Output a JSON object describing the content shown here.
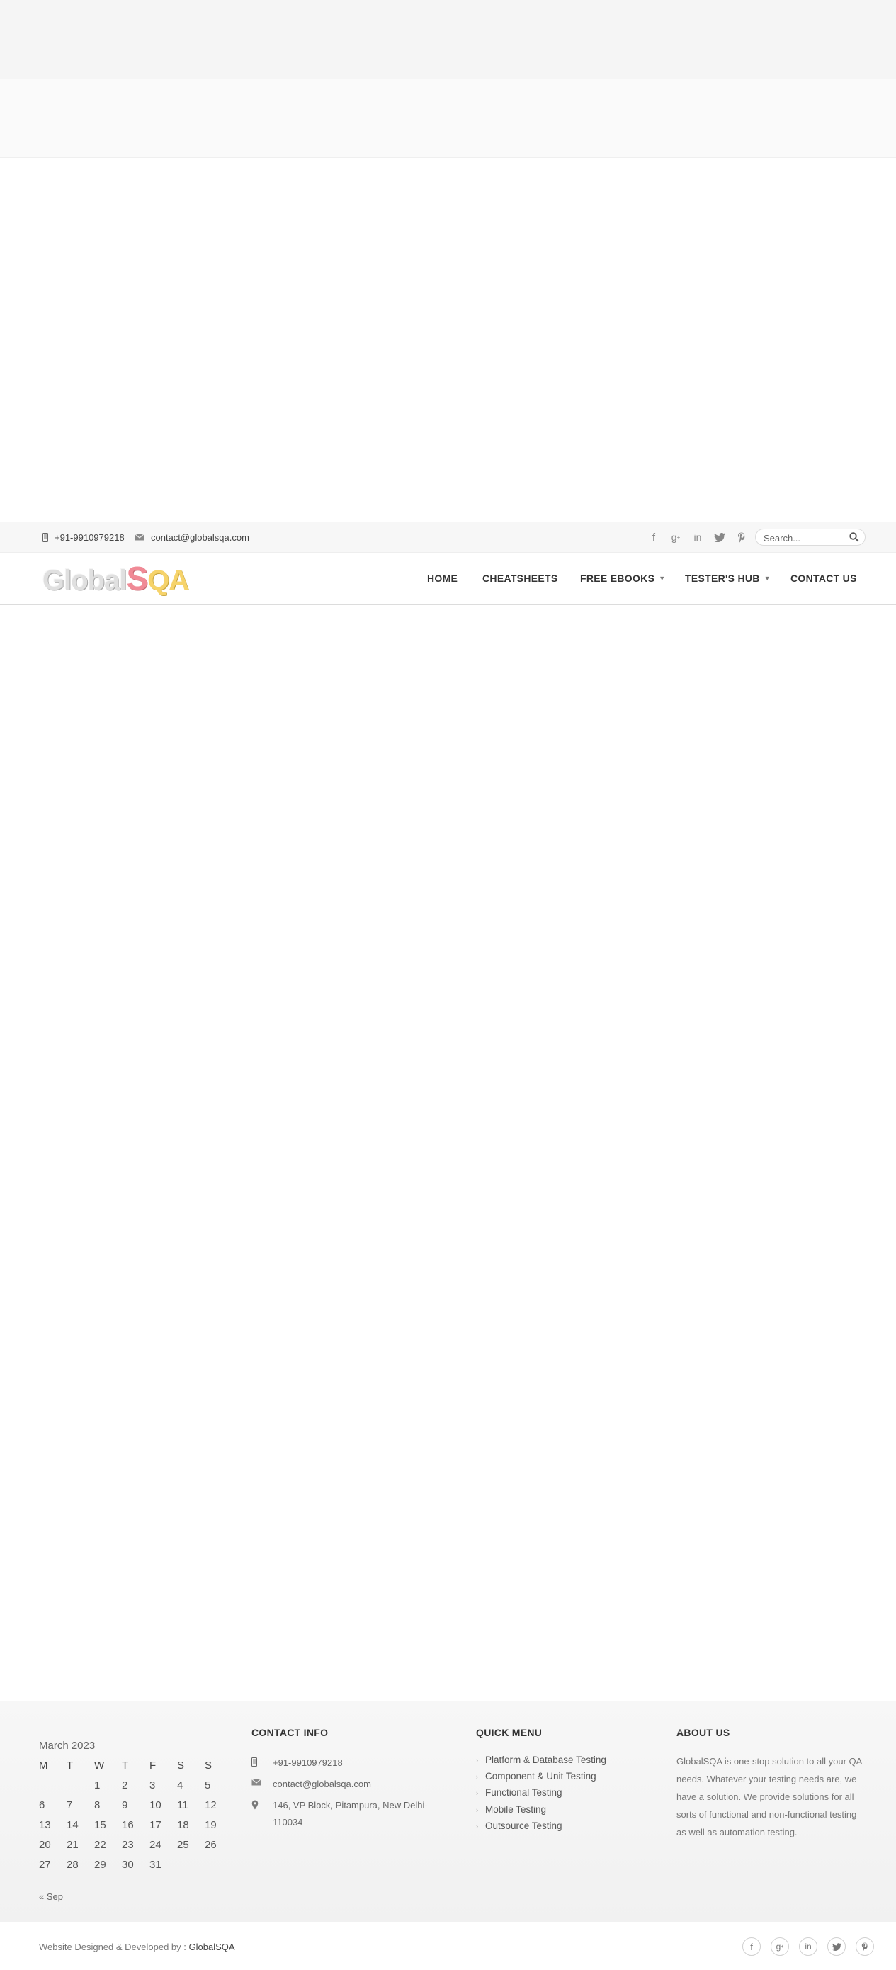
{
  "topbar": {
    "phone": "+91-9910979218",
    "email": "contact@globalsqa.com",
    "socials": [
      "facebook-icon",
      "google-plus-icon",
      "linkedin-icon",
      "twitter-icon",
      "pinterest-icon"
    ],
    "search_placeholder": "Search..."
  },
  "logo": {
    "part1": "Global",
    "part2": "S",
    "part3": "QA"
  },
  "nav": {
    "home": "HOME",
    "cheatsheets": "CHEATSHEETS",
    "free_ebooks": "FREE EBOOKS",
    "testers_hub": "TESTER'S HUB",
    "contact_us": "CONTACT US"
  },
  "footer": {
    "calendar": {
      "caption": "March 2023",
      "days": [
        "M",
        "T",
        "W",
        "T",
        "F",
        "S",
        "S"
      ],
      "weeks": [
        [
          "",
          "",
          "1",
          "2",
          "3",
          "4",
          "5"
        ],
        [
          "6",
          "7",
          "8",
          "9",
          "10",
          "11",
          "12"
        ],
        [
          "13",
          "14",
          "15",
          "16",
          "17",
          "18",
          "19"
        ],
        [
          "20",
          "21",
          "22",
          "23",
          "24",
          "25",
          "26"
        ],
        [
          "27",
          "28",
          "29",
          "30",
          "31",
          "",
          ""
        ]
      ],
      "prev": "« Sep"
    },
    "contact": {
      "title": "CONTACT INFO",
      "phone": "+91-9910979218",
      "email": "contact@globalsqa.com",
      "address_line1": "146, VP Block, Pitampura, New Delhi-",
      "address_line2": "110034"
    },
    "quick_menu": {
      "title": "QUICK MENU",
      "items": [
        "Platform & Database Testing",
        "Component & Unit Testing",
        "Functional Testing",
        "Mobile Testing",
        "Outsource Testing"
      ]
    },
    "about": {
      "title": "ABOUT US",
      "text": "GlobalSQA is one-stop solution to all your QA needs. Whatever your testing needs are, we have a solution. We provide solutions for all sorts of functional and non-functional testing as well as automation testing."
    }
  },
  "bottom": {
    "credit_prefix": "Website Designed & Developed by : ",
    "credit_brand": "GlobalSQA",
    "socials": [
      "facebook-icon",
      "google-plus-icon",
      "linkedin-icon",
      "twitter-icon",
      "pinterest-icon"
    ]
  }
}
